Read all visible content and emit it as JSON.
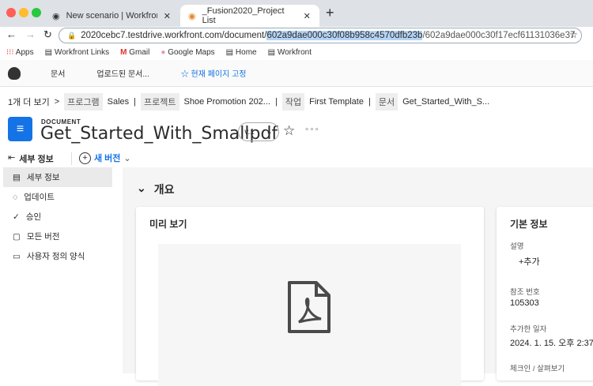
{
  "browser": {
    "tabs": [
      {
        "label": "New scenario | Workfront Fusi"
      },
      {
        "label": "_Fusion2020_Project List"
      }
    ],
    "url_host": "2020cebc7.testdrive.workfront.com/document/",
    "url_selected": "602a9dae000c30f08b958c4570dfb23b",
    "url_rest": "/602a9dae000c30f17ecf61131036e37",
    "bookmarks": [
      "Apps",
      "Workfront Links",
      "Gmail",
      "Google Maps",
      "Home",
      "Workfront"
    ]
  },
  "app_header": {
    "items": [
      "문서",
      "업로드된 문서..."
    ],
    "pin": "현재 페이지 고정"
  },
  "breadcrumb": {
    "more": "1개 더 보기",
    "items": [
      {
        "type": "프로그램",
        "name": "Sales"
      },
      {
        "type": "프로젝트",
        "name": "Shoe Promotion 202..."
      },
      {
        "type": "작업",
        "name": "First Template"
      },
      {
        "type": "문서",
        "name": "Get_Started_With_S..."
      }
    ]
  },
  "document": {
    "kind": "DOCUMENT",
    "title": "Get_Started_With_Smallpdf",
    "version": "v.1"
  },
  "toolbar": {
    "details": "세부 정보",
    "new_version": "새 버전"
  },
  "sidebar": {
    "items": [
      "세부 정보",
      "업데이트",
      "승인",
      "모든 버전",
      "사용자 정의 양식"
    ]
  },
  "overview": {
    "title": "개요",
    "preview_title": "미리 보기",
    "info": {
      "title": "기본 정보",
      "desc_label": "설명",
      "desc_add": "+추가",
      "ref_label": "참조 번호",
      "ref_value": "105303",
      "added_label": "추가한 일자",
      "added_value": "2024. 1. 15. 오후 2:37",
      "checkin_label": "체크인 / 살펴보기"
    }
  }
}
